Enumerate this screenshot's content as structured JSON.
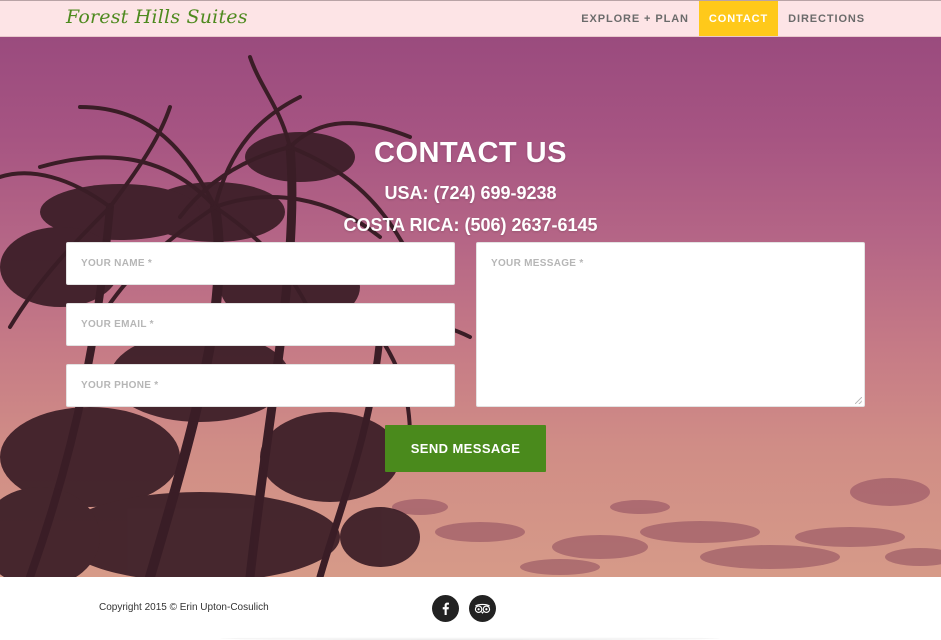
{
  "navbar": {
    "brand": "Forest Hills Suites",
    "items": [
      {
        "label": "EXPLORE + PLAN",
        "active": false
      },
      {
        "label": "CONTACT",
        "active": true
      },
      {
        "label": "DIRECTIONS",
        "active": false
      }
    ],
    "background_color": "#fde4e6",
    "active_color": "#ffc91a",
    "brand_color": "#4e8a1f"
  },
  "hero": {
    "title": "CONTACT US",
    "phone_usa": "USA: (724) 699-9238",
    "phone_costa_rica": "COSTA RICA: (506) 2637-6145"
  },
  "form": {
    "name_placeholder": "YOUR NAME *",
    "email_placeholder": "YOUR EMAIL *",
    "phone_placeholder": "YOUR PHONE *",
    "message_placeholder": "YOUR MESSAGE *",
    "submit_label": "SEND MESSAGE",
    "submit_color": "#4a8a1c"
  },
  "footer": {
    "copyright": "Copyright 2015 © Erin Upton-Cosulich",
    "social_icons": [
      "facebook-icon",
      "tripadvisor-icon"
    ]
  }
}
